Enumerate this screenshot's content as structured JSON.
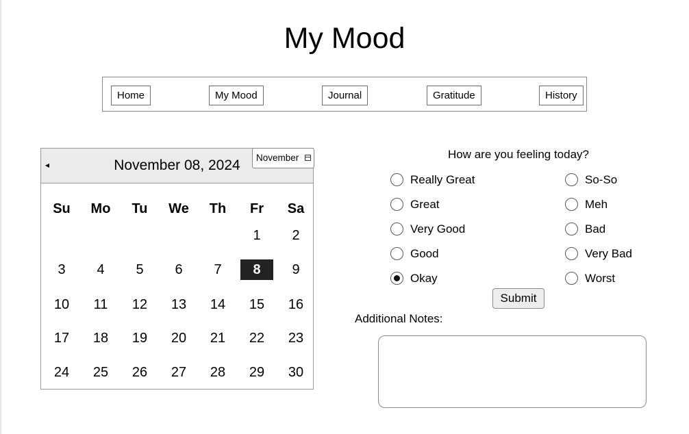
{
  "page": {
    "title": "My Mood"
  },
  "nav": {
    "items": [
      {
        "label": "Home"
      },
      {
        "label": "My Mood"
      },
      {
        "label": "Journal"
      },
      {
        "label": "Gratitude"
      },
      {
        "label": "History"
      }
    ]
  },
  "calendar": {
    "prev_icon": "caret-left-icon",
    "selected_date_label": "November 08, 2024",
    "month_select": {
      "value": "November",
      "icon": "calendar-icon"
    },
    "weekdays": [
      "Su",
      "Mo",
      "Tu",
      "We",
      "Th",
      "Fr",
      "Sa"
    ],
    "days": [
      "1",
      "2",
      "3",
      "4",
      "5",
      "6",
      "7",
      "8",
      "9",
      "10",
      "11",
      "12",
      "13",
      "14",
      "15",
      "16",
      "17",
      "18",
      "19",
      "20",
      "21",
      "22",
      "23",
      "24",
      "25",
      "26",
      "27",
      "28",
      "29",
      "30"
    ],
    "selected_day": "8",
    "selected_color": "#222222"
  },
  "mood": {
    "question": "How are you feeling today?",
    "options": [
      {
        "label": "Really Great",
        "checked": false
      },
      {
        "label": "Great",
        "checked": false
      },
      {
        "label": "Very Good",
        "checked": false
      },
      {
        "label": "Good",
        "checked": false
      },
      {
        "label": "Okay",
        "checked": true
      },
      {
        "label": "So-So",
        "checked": false
      },
      {
        "label": "Meh",
        "checked": false
      },
      {
        "label": "Bad",
        "checked": false
      },
      {
        "label": "Very Bad",
        "checked": false
      },
      {
        "label": "Worst",
        "checked": false
      }
    ],
    "submit_label": "Submit"
  },
  "notes": {
    "label": "Additional Notes:",
    "value": ""
  }
}
